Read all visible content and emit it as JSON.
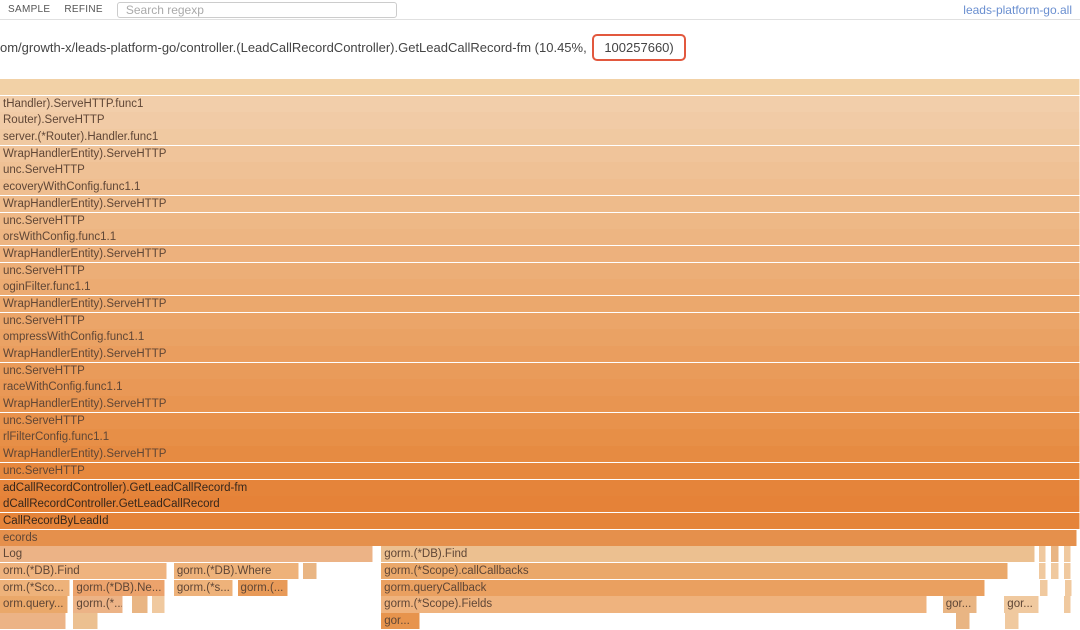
{
  "toolbar": {
    "sample_label": "SAMPLE",
    "refine_label": "REFINE",
    "search_placeholder": "Search regexp",
    "link_text": "leads-platform-go.all"
  },
  "breadcrumb": {
    "path_prefix": "om/growth-x/leads-platform-go/controller.(LeadCallRecordController).GetLeadCallRecord-fm (10.45%,",
    "highlighted": "100257660)"
  },
  "flame_rows_full": [
    "",
    "tHandler).ServeHTTP.func1",
    "Router).ServeHTTP",
    "server.(*Router).Handler.func1",
    "WrapHandlerEntity).ServeHTTP",
    "unc.ServeHTTP",
    "ecoveryWithConfig.func1.1",
    "WrapHandlerEntity).ServeHTTP",
    "unc.ServeHTTP",
    "orsWithConfig.func1.1",
    "WrapHandlerEntity).ServeHTTP",
    "unc.ServeHTTP",
    "oginFilter.func1.1",
    "WrapHandlerEntity).ServeHTTP",
    "unc.ServeHTTP",
    "ompressWithConfig.func1.1",
    "WrapHandlerEntity).ServeHTTP",
    "unc.ServeHTTP",
    "raceWithConfig.func1.1",
    "WrapHandlerEntity).ServeHTTP",
    "unc.ServeHTTP",
    "rlFilterConfig.func1.1",
    "WrapHandlerEntity).ServeHTTP",
    "unc.ServeHTTP",
    "adCallRecordController).GetLeadCallRecord-fm",
    "dCallRecordController.GetLeadCallRecord",
    "CallRecordByLeadId",
    "ecords"
  ],
  "bottom": {
    "row0_left": "Log",
    "row0_right": "gorm.(*DB).Find",
    "row1_a": "orm.(*DB).Find",
    "row1_b": "gorm.(*DB).Where",
    "row1_right": "gorm.(*Scope).callCallbacks",
    "row2_a": "orm.(*Sco...",
    "row2_b": "gorm.(*DB).Ne...",
    "row2_c": "gorm.(*s...",
    "row2_d": "gorm.(...",
    "row2_right": "gorm.queryCallback",
    "row3_a": "orm.query...",
    "row3_b": "gorm.(*...",
    "row3_right": "gorm.(*Scope).Fields",
    "row3_far_a": "gor...",
    "row3_far_b": "gor...",
    "row4_right": "gor..."
  }
}
